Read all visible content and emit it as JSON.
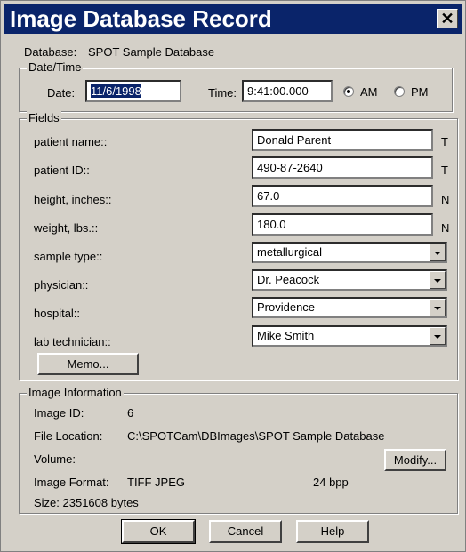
{
  "window": {
    "title": "Image Database Record",
    "close_glyph": "✕"
  },
  "database": {
    "label": "Database:",
    "value": "SPOT Sample Database"
  },
  "datetime": {
    "legend": "Date/Time",
    "date_label": "Date:",
    "date_value": "11/6/1998",
    "time_label": "Time:",
    "time_value": "9:41:00.000",
    "am_label": "AM",
    "pm_label": "PM",
    "selected": "AM"
  },
  "fields": {
    "legend": "Fields",
    "items": [
      {
        "label": "patient name::",
        "value": "Donald Parent",
        "type": "T"
      },
      {
        "label": "patient ID::",
        "value": "490-87-2640",
        "type": "T"
      },
      {
        "label": "height, inches::",
        "value": "67.0",
        "type": "N"
      },
      {
        "label": "weight, lbs.::",
        "value": "180.0",
        "type": "N"
      },
      {
        "label": "sample type::",
        "value": "metallurgical"
      },
      {
        "label": "physician::",
        "value": "Dr. Peacock"
      },
      {
        "label": "hospital::",
        "value": "Providence"
      },
      {
        "label": "lab technician::",
        "value": "Mike Smith"
      }
    ],
    "memo_button": "Memo..."
  },
  "image_info": {
    "legend": "Image Information",
    "id_label": "Image ID:",
    "id_value": "6",
    "location_label": "File Location:",
    "location_value": "C:\\SPOTCam\\DBImages\\SPOT Sample Database",
    "volume_label": "Volume:",
    "modify_button": "Modify...",
    "format_label": "Image Format:",
    "format_value": "TIFF JPEG",
    "bpp": "24  bpp",
    "size_text": "Size:  2351608 bytes"
  },
  "buttons": {
    "ok": "OK",
    "cancel": "Cancel",
    "help": "Help"
  }
}
